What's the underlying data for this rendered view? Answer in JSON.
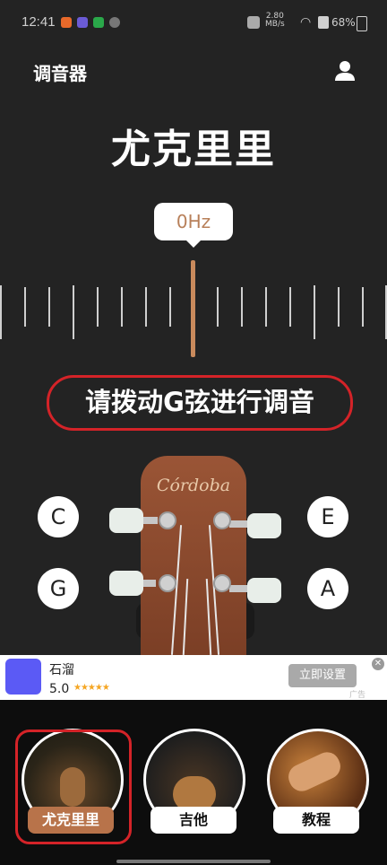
{
  "status_bar": {
    "time": "12:41",
    "net_speed_value": "2.80",
    "net_speed_unit": "MB/s",
    "battery": "68%"
  },
  "header": {
    "app_title": "调音器"
  },
  "instrument_title": "尤克里里",
  "frequency": "0Hz",
  "instruction": "请拨动G弦进行调音",
  "headstock": {
    "brand": "Córdoba"
  },
  "notes": {
    "top_left": "C",
    "bottom_left": "G",
    "top_right": "E",
    "bottom_right": "A"
  },
  "ad": {
    "app_name": "石溜",
    "rating": "5.0",
    "stars": "★★★★★",
    "button": "立即设置",
    "close": "✕",
    "label": "广告"
  },
  "tabs": [
    {
      "label": "尤克里里"
    },
    {
      "label": "吉他"
    },
    {
      "label": "教程"
    }
  ],
  "colors": {
    "background": "#232323",
    "accent": "#c98a5c",
    "highlight_red": "#d42328",
    "selected_tab": "#b8734a"
  }
}
